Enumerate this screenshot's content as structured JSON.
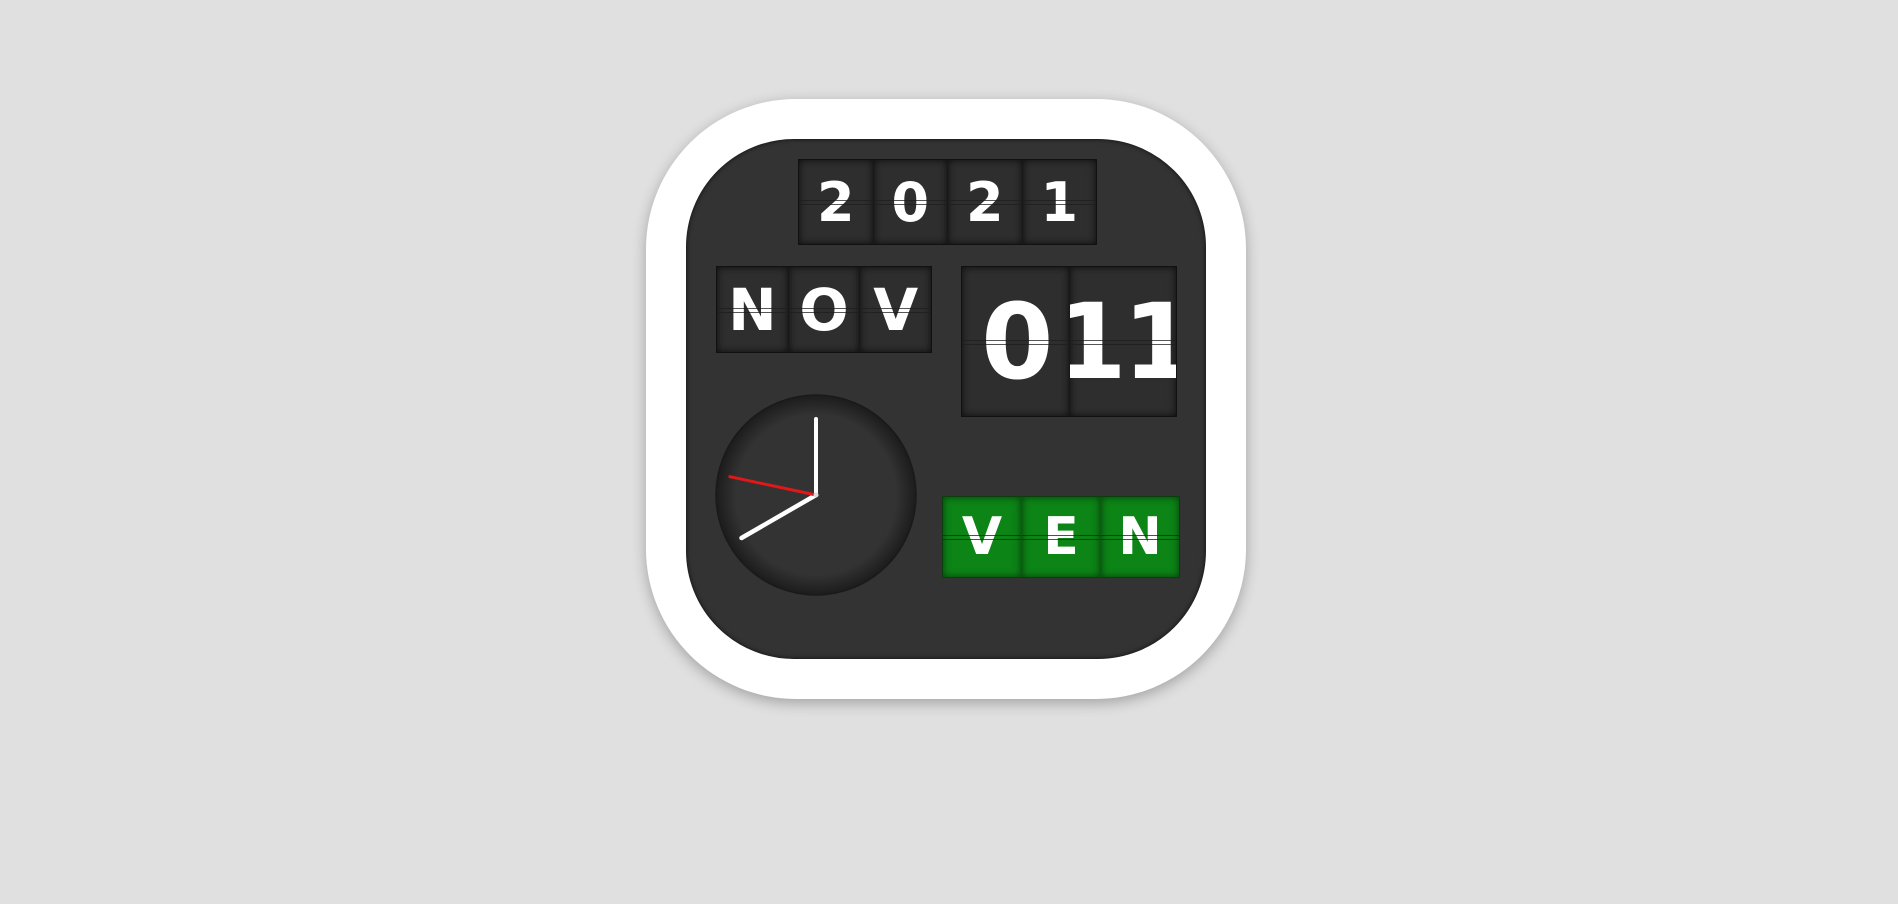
{
  "widget": {
    "year_digits": [
      "2",
      "0",
      "2",
      "1"
    ],
    "month_letters": [
      "N",
      "O",
      "V"
    ],
    "day_digits": [
      "0",
      "11"
    ],
    "weekday_letters": [
      "V",
      "E",
      "N"
    ],
    "clock": {
      "hour": 8,
      "minute": 0,
      "second": 47
    },
    "colors": {
      "background": "#e0e0e0",
      "frame": "#ffffff",
      "panel": "#333333",
      "weekday_accent": "#0c8416",
      "second_hand": "#e01818",
      "hands": "#ffffff"
    }
  }
}
